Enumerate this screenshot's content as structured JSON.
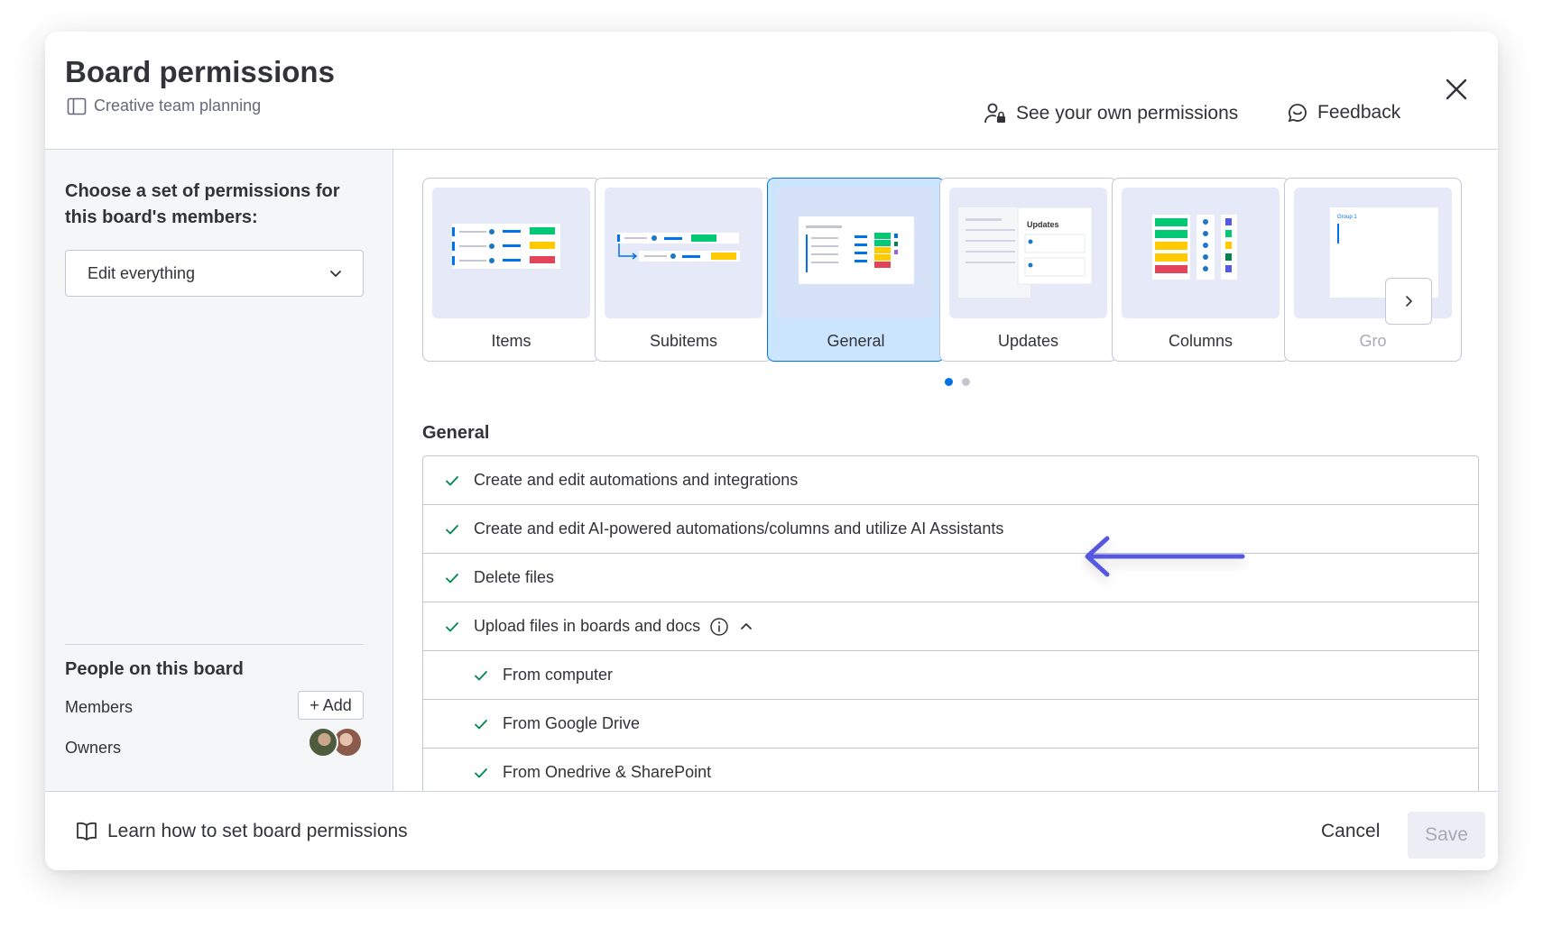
{
  "header": {
    "title": "Board permissions",
    "board_name": "Creative team planning",
    "own_permissions_label": "See your own permissions",
    "feedback_label": "Feedback"
  },
  "left_panel": {
    "heading": "Choose a set of permissions for this board's members:",
    "permission_set": {
      "selected": "Edit everything"
    },
    "people_title": "People on this board",
    "members_label": "Members",
    "add_label": "+ Add",
    "owners_label": "Owners"
  },
  "carousel": {
    "cards": [
      {
        "label": "Items",
        "selected": false
      },
      {
        "label": "Subitems",
        "selected": false
      },
      {
        "label": "General",
        "selected": true
      },
      {
        "label": "Updates",
        "selected": false
      },
      {
        "label": "Columns",
        "selected": false
      },
      {
        "label": "Gro",
        "selected": false
      }
    ],
    "updates_thumb_title": "Updates",
    "groups_thumb_title": "Group 1",
    "pages": 2,
    "active_page": 1
  },
  "section": {
    "title": "General",
    "permissions": [
      {
        "label": "Create and edit automations and integrations",
        "checked": true,
        "sub": false
      },
      {
        "label": "Create and edit AI-powered automations/columns and utilize AI Assistants",
        "checked": true,
        "sub": false
      },
      {
        "label": "Delete files",
        "checked": true,
        "sub": false
      },
      {
        "label": "Upload files in boards and docs",
        "checked": true,
        "sub": false
      },
      {
        "label": "From computer",
        "checked": true,
        "sub": true
      },
      {
        "label": "From Google Drive",
        "checked": true,
        "sub": true
      },
      {
        "label": "From Onedrive & SharePoint",
        "checked": true,
        "sub": true
      }
    ]
  },
  "footer": {
    "learn_label": "Learn how to set board permissions",
    "cancel_label": "Cancel",
    "save_label": "Save"
  },
  "colors": {
    "accent": "#0073ea",
    "check": "#00854d",
    "arrow": "#5559df",
    "selected_card_bg": "#cce5ff"
  },
  "icons": {
    "board": "board-icon",
    "own_permissions": "user-lock-icon",
    "feedback": "feedback-chat-icon",
    "close": "close-icon",
    "dropdown": "chevron-down-icon",
    "info": "info-icon",
    "collapse": "chevron-up-icon",
    "learn": "book-icon",
    "check": "check-icon"
  }
}
